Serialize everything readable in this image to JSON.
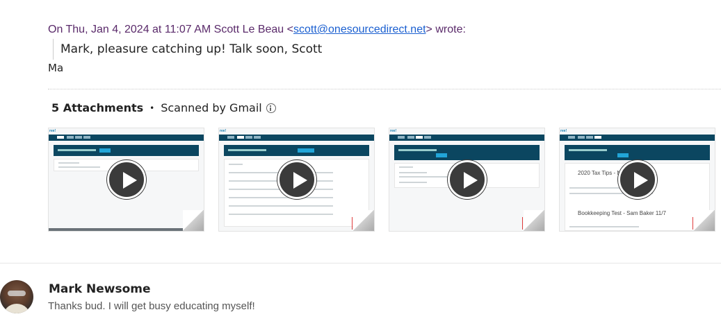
{
  "quote": {
    "header_prefix": "On Thu, Jan 4, 2024 at 11:07 AM Scott Le Beau <",
    "email": "scott@onesourcedirect.net",
    "header_suffix": "> wrote:",
    "body": "Mark, pleasure catching up!  Talk soon, Scott"
  },
  "signature_trail": "Ma",
  "attachments": {
    "count_label": "5 Attachments",
    "separator": "•",
    "scan_label": "Scanned by Gmail",
    "items": [
      {
        "logo": "ree!"
      },
      {
        "logo": "ree!"
      },
      {
        "logo": "ree!"
      },
      {
        "logo": "ree!"
      }
    ],
    "thumb_texts": {
      "t4_line1": "2020 Tax Tips - Nov 7",
      "t4_line2": "Bookkeeping Test - Sam Baker 11/7"
    }
  },
  "reply": {
    "sender": "Mark Newsome",
    "snippet": "Thanks bud. I will get busy educating myself!"
  },
  "colors": {
    "link": "#1a5fd0",
    "quote_header": "#5a2a6a",
    "thumb_nav": "#0b4660",
    "thumb_button": "#21a5d8"
  }
}
